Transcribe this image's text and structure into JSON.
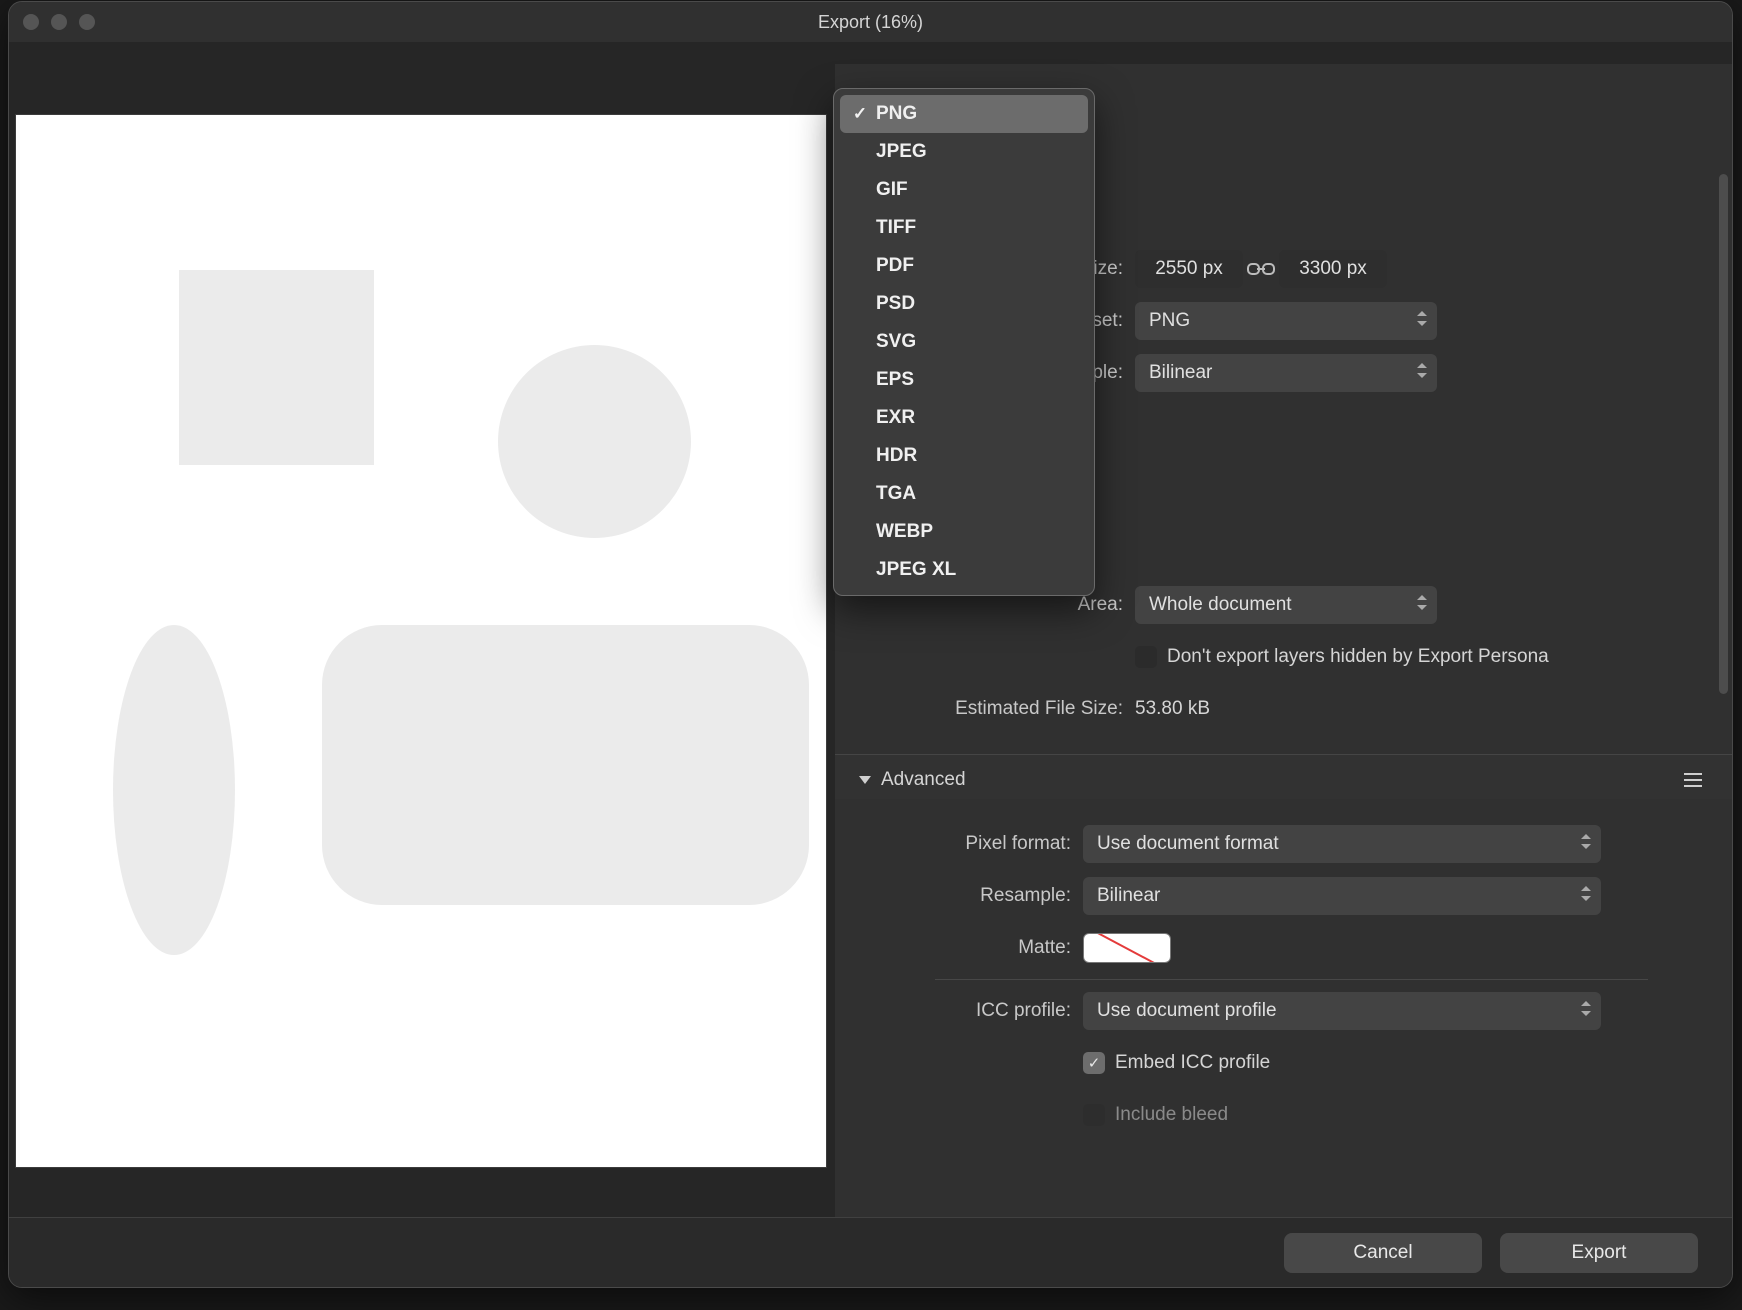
{
  "window": {
    "title": "Export (16%)"
  },
  "dropdown": {
    "selected": "PNG",
    "options": [
      "PNG",
      "JPEG",
      "GIF",
      "TIFF",
      "PDF",
      "PSD",
      "SVG",
      "EPS",
      "EXR",
      "HDR",
      "TGA",
      "WEBP",
      "JPEG XL"
    ]
  },
  "fields": {
    "size_label": "Size:",
    "width": "2550 px",
    "height": "3300 px",
    "preset_label": "Preset:",
    "preset_value": "PNG",
    "resample_label_short": "Resample:",
    "resample_value_short": "Bilinear",
    "area_label": "Area:",
    "area_value": "Whole document",
    "dont_export_label": "Don't export layers hidden by Export Persona",
    "est_label": "Estimated File Size:",
    "est_value": "53.80 kB"
  },
  "advanced": {
    "header": "Advanced",
    "pixel_format_label": "Pixel format:",
    "pixel_format_value": "Use document format",
    "resample_label": "Resample:",
    "resample_value": "Bilinear",
    "matte_label": "Matte:",
    "icc_label": "ICC profile:",
    "icc_value": "Use document profile",
    "embed_icc_label": "Embed ICC profile",
    "include_bleed_label": "Include bleed"
  },
  "footer": {
    "cancel": "Cancel",
    "export": "Export"
  }
}
